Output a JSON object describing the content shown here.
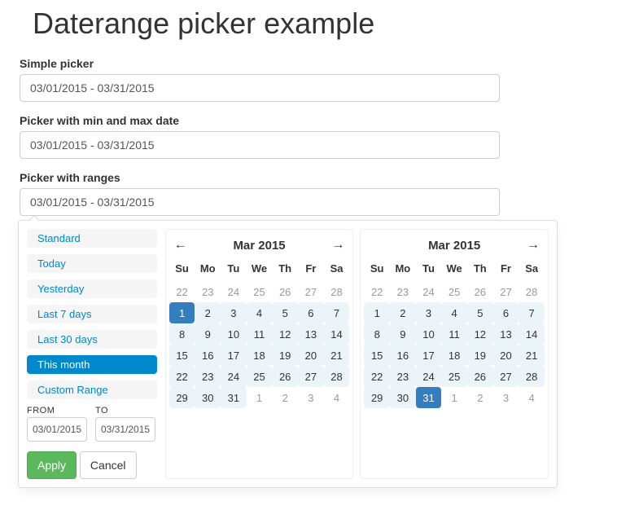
{
  "title": "Daterange picker example",
  "pickers": {
    "simple": {
      "label": "Simple picker",
      "value": "03/01/2015 - 03/31/2015"
    },
    "minmax": {
      "label": "Picker with min and max date",
      "value": "03/01/2015 - 03/31/2015"
    },
    "ranges": {
      "label": "Picker with ranges",
      "value": "03/01/2015 - 03/31/2015"
    }
  },
  "drp": {
    "presets": [
      {
        "label": "Standard",
        "active": false
      },
      {
        "label": "Today",
        "active": false
      },
      {
        "label": "Yesterday",
        "active": false
      },
      {
        "label": "Last 7 days",
        "active": false
      },
      {
        "label": "Last 30 days",
        "active": false
      },
      {
        "label": "This month",
        "active": true
      },
      {
        "label": "Custom Range",
        "active": false
      }
    ],
    "fromLabel": "FROM",
    "toLabel": "TO",
    "fromValue": "03/01/2015",
    "toValue": "03/31/2015",
    "applyLabel": "Apply",
    "cancelLabel": "Cancel",
    "dow": [
      "Su",
      "Mo",
      "Tu",
      "We",
      "Th",
      "Fr",
      "Sa"
    ],
    "left": {
      "title": "Mar 2015",
      "showPrev": true,
      "showNext": true,
      "weeks": [
        [
          {
            "d": 22,
            "off": true
          },
          {
            "d": 23,
            "off": true
          },
          {
            "d": 24,
            "off": true
          },
          {
            "d": 25,
            "off": true
          },
          {
            "d": 26,
            "off": true
          },
          {
            "d": 27,
            "off": true
          },
          {
            "d": 28,
            "off": true
          }
        ],
        [
          {
            "d": 1,
            "start": true,
            "in": true
          },
          {
            "d": 2,
            "in": true
          },
          {
            "d": 3,
            "in": true
          },
          {
            "d": 4,
            "in": true
          },
          {
            "d": 5,
            "in": true
          },
          {
            "d": 6,
            "in": true
          },
          {
            "d": 7,
            "in": true
          }
        ],
        [
          {
            "d": 8,
            "in": true
          },
          {
            "d": 9,
            "in": true
          },
          {
            "d": 10,
            "in": true
          },
          {
            "d": 11,
            "in": true
          },
          {
            "d": 12,
            "in": true
          },
          {
            "d": 13,
            "in": true
          },
          {
            "d": 14,
            "in": true
          }
        ],
        [
          {
            "d": 15,
            "in": true
          },
          {
            "d": 16,
            "in": true
          },
          {
            "d": 17,
            "in": true
          },
          {
            "d": 18,
            "in": true
          },
          {
            "d": 19,
            "in": true
          },
          {
            "d": 20,
            "in": true
          },
          {
            "d": 21,
            "in": true
          }
        ],
        [
          {
            "d": 22,
            "in": true
          },
          {
            "d": 23,
            "in": true
          },
          {
            "d": 24,
            "in": true
          },
          {
            "d": 25,
            "in": true
          },
          {
            "d": 26,
            "in": true
          },
          {
            "d": 27,
            "in": true
          },
          {
            "d": 28,
            "in": true
          }
        ],
        [
          {
            "d": 29,
            "in": true
          },
          {
            "d": 30,
            "in": true
          },
          {
            "d": 31,
            "in": true
          },
          {
            "d": 1,
            "off": true
          },
          {
            "d": 2,
            "off": true
          },
          {
            "d": 3,
            "off": true
          },
          {
            "d": 4,
            "off": true
          }
        ]
      ]
    },
    "right": {
      "title": "Mar 2015",
      "showPrev": false,
      "showNext": true,
      "weeks": [
        [
          {
            "d": 22,
            "off": true
          },
          {
            "d": 23,
            "off": true
          },
          {
            "d": 24,
            "off": true
          },
          {
            "d": 25,
            "off": true
          },
          {
            "d": 26,
            "off": true
          },
          {
            "d": 27,
            "off": true
          },
          {
            "d": 28,
            "off": true
          }
        ],
        [
          {
            "d": 1,
            "in": true
          },
          {
            "d": 2,
            "in": true
          },
          {
            "d": 3,
            "in": true
          },
          {
            "d": 4,
            "in": true
          },
          {
            "d": 5,
            "in": true
          },
          {
            "d": 6,
            "in": true
          },
          {
            "d": 7,
            "in": true
          }
        ],
        [
          {
            "d": 8,
            "in": true
          },
          {
            "d": 9,
            "in": true
          },
          {
            "d": 10,
            "in": true
          },
          {
            "d": 11,
            "in": true
          },
          {
            "d": 12,
            "in": true
          },
          {
            "d": 13,
            "in": true
          },
          {
            "d": 14,
            "in": true
          }
        ],
        [
          {
            "d": 15,
            "in": true
          },
          {
            "d": 16,
            "in": true
          },
          {
            "d": 17,
            "in": true
          },
          {
            "d": 18,
            "in": true
          },
          {
            "d": 19,
            "in": true
          },
          {
            "d": 20,
            "in": true
          },
          {
            "d": 21,
            "in": true
          }
        ],
        [
          {
            "d": 22,
            "in": true
          },
          {
            "d": 23,
            "in": true
          },
          {
            "d": 24,
            "in": true
          },
          {
            "d": 25,
            "in": true
          },
          {
            "d": 26,
            "in": true
          },
          {
            "d": 27,
            "in": true
          },
          {
            "d": 28,
            "in": true
          }
        ],
        [
          {
            "d": 29,
            "in": true
          },
          {
            "d": 30,
            "in": true
          },
          {
            "d": 31,
            "end": true,
            "in": true
          },
          {
            "d": 1,
            "off": true
          },
          {
            "d": 2,
            "off": true
          },
          {
            "d": 3,
            "off": true
          },
          {
            "d": 4,
            "off": true
          }
        ]
      ]
    }
  }
}
